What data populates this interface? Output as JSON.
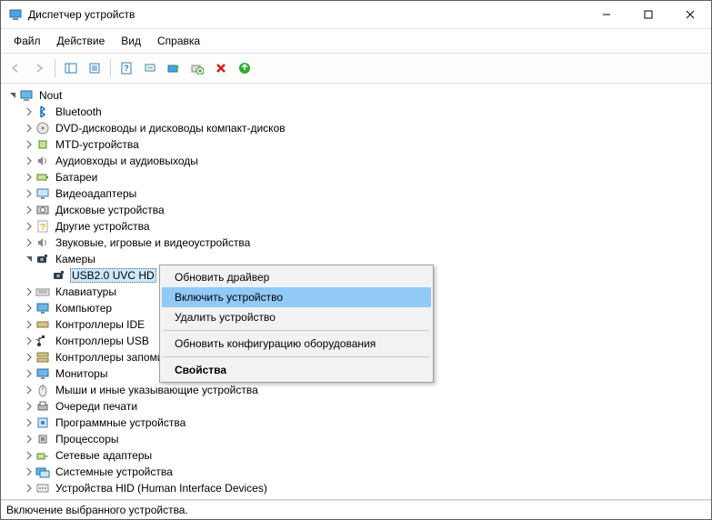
{
  "title": "Диспетчер устройств",
  "menus": {
    "file": "Файл",
    "action": "Действие",
    "view": "Вид",
    "help": "Справка"
  },
  "root": "Nout",
  "categories": [
    {
      "id": "bluetooth",
      "label": "Bluetooth",
      "icon": "bt",
      "expandable": true
    },
    {
      "id": "dvd",
      "label": "DVD-дисководы и дисководы компакт-дисков",
      "icon": "disc",
      "expandable": true
    },
    {
      "id": "mtd",
      "label": "MTD-устройства",
      "icon": "chip",
      "expandable": true
    },
    {
      "id": "audio",
      "label": "Аудиовходы и аудиовыходы",
      "icon": "speaker",
      "expandable": true
    },
    {
      "id": "battery",
      "label": "Батареи",
      "icon": "battery",
      "expandable": true
    },
    {
      "id": "video",
      "label": "Видеоадаптеры",
      "icon": "display",
      "expandable": true
    },
    {
      "id": "disk",
      "label": "Дисковые устройства",
      "icon": "hdd",
      "expandable": true
    },
    {
      "id": "other",
      "label": "Другие устройства",
      "icon": "unknown",
      "expandable": true
    },
    {
      "id": "soundgame",
      "label": "Звуковые, игровые и видеоустройства",
      "icon": "speaker",
      "expandable": true
    },
    {
      "id": "cameras",
      "label": "Камеры",
      "icon": "camera",
      "expandable": true,
      "expanded": true,
      "children": [
        {
          "id": "cam0",
          "label": "USB2.0 UVC HD",
          "icon": "camera",
          "selected": true
        }
      ]
    },
    {
      "id": "keyboard",
      "label": "Клавиатуры",
      "icon": "keyboard",
      "expandable": true
    },
    {
      "id": "computer",
      "label": "Компьютер",
      "icon": "monitor",
      "expandable": true
    },
    {
      "id": "ide",
      "label": "Контроллеры IDE",
      "icon": "ide",
      "expandable": true,
      "truncated": true,
      "full": "Контроллеры IDE ATA/ATAPI"
    },
    {
      "id": "usb",
      "label": "Контроллеры USB",
      "icon": "usb",
      "expandable": true,
      "truncated": true,
      "full": "Контроллеры USB"
    },
    {
      "id": "storage",
      "label": "Контроллеры запоминающих устройств",
      "icon": "storage",
      "expandable": true,
      "truncated": true
    },
    {
      "id": "monitors",
      "label": "Мониторы",
      "icon": "monitor",
      "expandable": true
    },
    {
      "id": "mice",
      "label": "Мыши и иные указывающие устройства",
      "icon": "mouse",
      "expandable": true,
      "truncated": true
    },
    {
      "id": "printq",
      "label": "Очереди печати",
      "icon": "printer",
      "expandable": true
    },
    {
      "id": "software",
      "label": "Программные устройства",
      "icon": "soft",
      "expandable": true
    },
    {
      "id": "cpu",
      "label": "Процессоры",
      "icon": "cpu",
      "expandable": true
    },
    {
      "id": "net",
      "label": "Сетевые адаптеры",
      "icon": "net",
      "expandable": true
    },
    {
      "id": "system",
      "label": "Системные устройства",
      "icon": "system",
      "expandable": true
    },
    {
      "id": "hid",
      "label": "Устройства HID (Human Interface Devices)",
      "icon": "hid",
      "expandable": true
    }
  ],
  "context_menu": {
    "items": [
      {
        "id": "upd",
        "label": "Обновить драйвер"
      },
      {
        "id": "enable",
        "label": "Включить устройство",
        "highlight": true
      },
      {
        "id": "remove",
        "label": "Удалить устройство"
      },
      {
        "sep": true
      },
      {
        "id": "scan",
        "label": "Обновить конфигурацию оборудования"
      },
      {
        "sep": true
      },
      {
        "id": "props",
        "label": "Свойства",
        "bold": true
      }
    ]
  },
  "status": "Включение выбранного устройства."
}
